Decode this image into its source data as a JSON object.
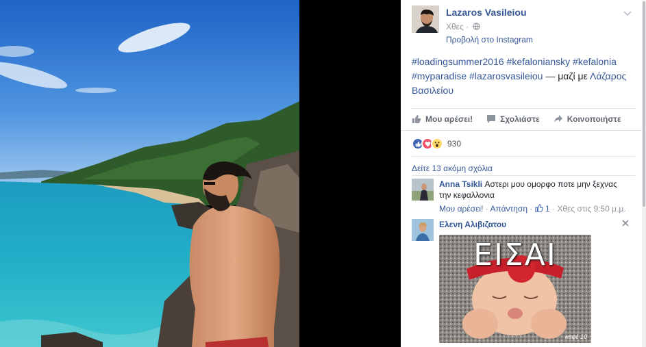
{
  "post": {
    "author": "Lazaros Vasileiou",
    "time": "Χθες",
    "separator": "·",
    "via_link": "Προβολή στο Instagram",
    "text_tags": "#loadingsummer2016 #kefaloniansky #kefalonia #myparadise #lazarosvasileiou",
    "text_with": "— μαζί με",
    "text_tagged": "Λάζαρος Βασιλείου"
  },
  "actions": {
    "like": "Μου αρέσει!",
    "comment": "Σχολιάστε",
    "share": "Κοινοποιήστε"
  },
  "reactions": {
    "icons": [
      "like-icon",
      "love-icon",
      "wow-icon"
    ],
    "count": "930"
  },
  "comments_section": {
    "view_more": "Δείτε 13 ακόμη σχόλια",
    "comments": [
      {
        "name": "Anna Tsikli",
        "text": "Αστερι μου ομορφο ποτε μην ξεχνας την κεφαλλονια",
        "like_label": "Μου αρέσει!",
        "reply_label": "Απάντηση",
        "dot": "·",
        "likes": "1",
        "time": "Χθες στις 9:50 μ.μ."
      },
      {
        "name": "Ελενη Αλιβιζατου",
        "sticker_text": "ΕΙΣΑΙ",
        "sticker_watermark": "καφέ 10"
      }
    ]
  },
  "colors": {
    "link": "#365899",
    "meta": "#90949c",
    "like_blue": "#4267b2",
    "love_red": "#f25268",
    "wow_yellow": "#fcd766"
  }
}
